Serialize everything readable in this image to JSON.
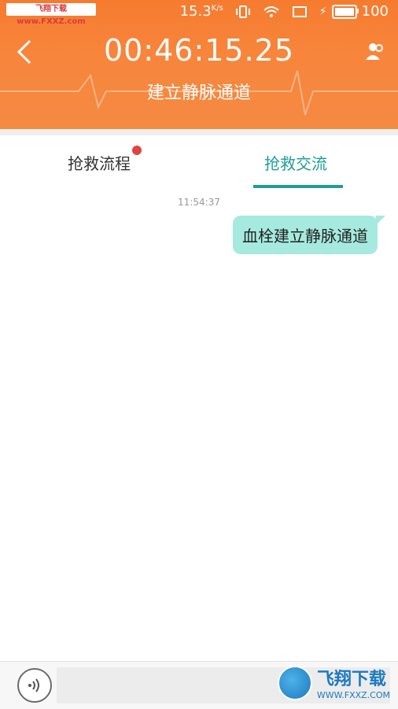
{
  "status_bar": {
    "left_badge": "飞翔下载 www.FXXZ.com",
    "speed": "15.3",
    "speed_unit": "K/s",
    "battery": "100"
  },
  "header": {
    "timer": "00:46:15.25",
    "subtitle": "建立静脉通道",
    "back_icon": "chevron-left-icon",
    "people_icon": "people-icon",
    "bg_color": "#f67b2f"
  },
  "tabs": {
    "left_label": "抢救流程",
    "right_label": "抢救交流",
    "active": "right",
    "accent": "#1f9e95",
    "badge_color": "#e0443f"
  },
  "chat": {
    "timestamp": "11:54:37",
    "messages": [
      {
        "text": "血栓建立静脉通道",
        "side": "right",
        "bubble_color": "#a6eadf"
      }
    ]
  },
  "input": {
    "placeholder": "",
    "voice_icon": "voice-wave-icon"
  },
  "watermark": {
    "big": "飞翔下载",
    "small": "WWW.FXXZ.COM"
  }
}
